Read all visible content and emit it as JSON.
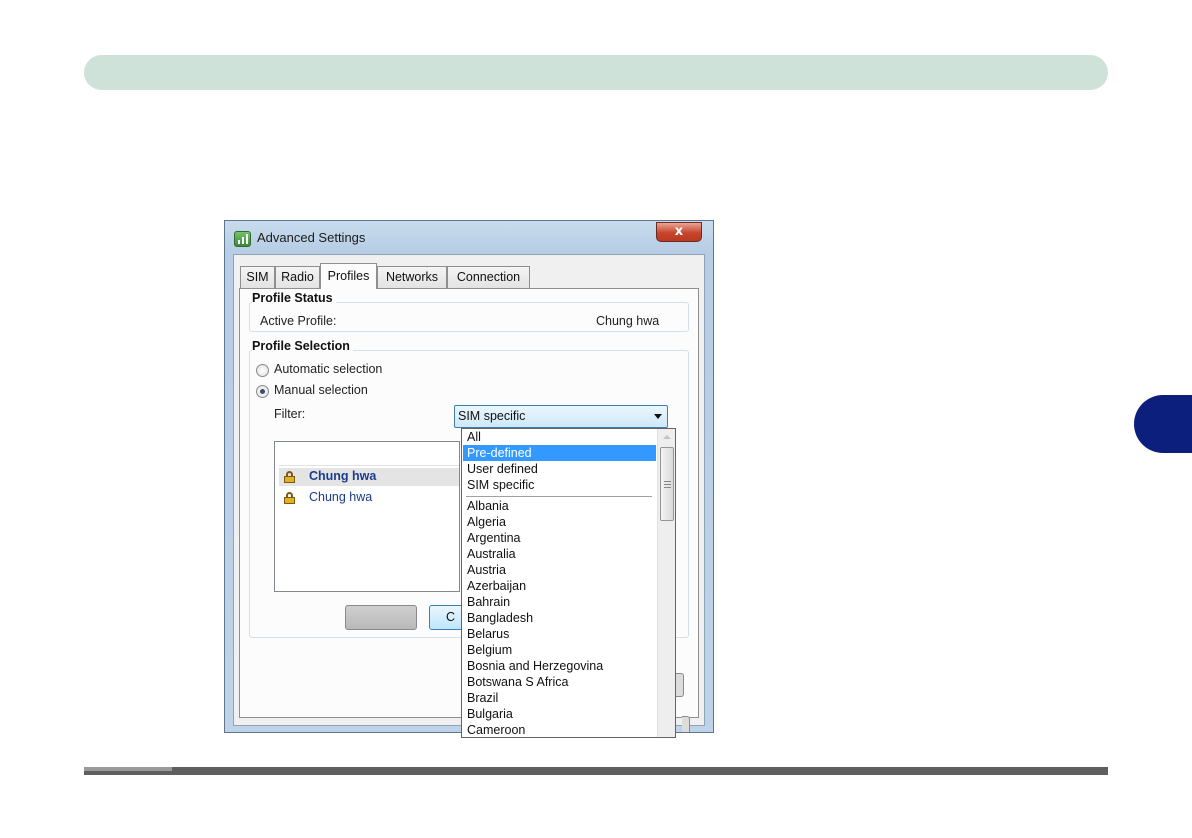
{
  "window": {
    "title": "Advanced Settings",
    "close_label": "x"
  },
  "tabs": [
    {
      "label": "SIM"
    },
    {
      "label": "Radio"
    },
    {
      "label": "Profiles"
    },
    {
      "label": "Networks"
    },
    {
      "label": "Connection"
    }
  ],
  "profile_status": {
    "heading": "Profile Status",
    "active_label": "Active Profile:",
    "active_value": "Chung hwa"
  },
  "profile_selection": {
    "heading": "Profile Selection",
    "automatic_label": "Automatic selection",
    "manual_label": "Manual selection",
    "filter_label": "Filter:",
    "filter_value": "SIM specific",
    "selected_mode": "manual"
  },
  "profiles": [
    {
      "name": "Chung hwa"
    },
    {
      "name": "Chung hwa"
    }
  ],
  "buttons": {
    "partial_label": "C"
  },
  "dropdown": {
    "highlighted": "Pre-defined",
    "items_top": [
      "All",
      "Pre-defined",
      "User defined",
      "SIM specific"
    ],
    "countries": [
      "Albania",
      "Algeria",
      "Argentina",
      "Australia",
      "Austria",
      "Azerbaijan",
      "Bahrain",
      "Bangladesh",
      "Belarus",
      "Belgium",
      "Bosnia and Herzegovina",
      "Botswana S Africa",
      "Brazil",
      "Bulgaria",
      "Cameroon"
    ]
  },
  "colors": {
    "header_band": "#cfe2da",
    "side_tab": "#0d1f7c",
    "highlight": "#3399ff"
  }
}
